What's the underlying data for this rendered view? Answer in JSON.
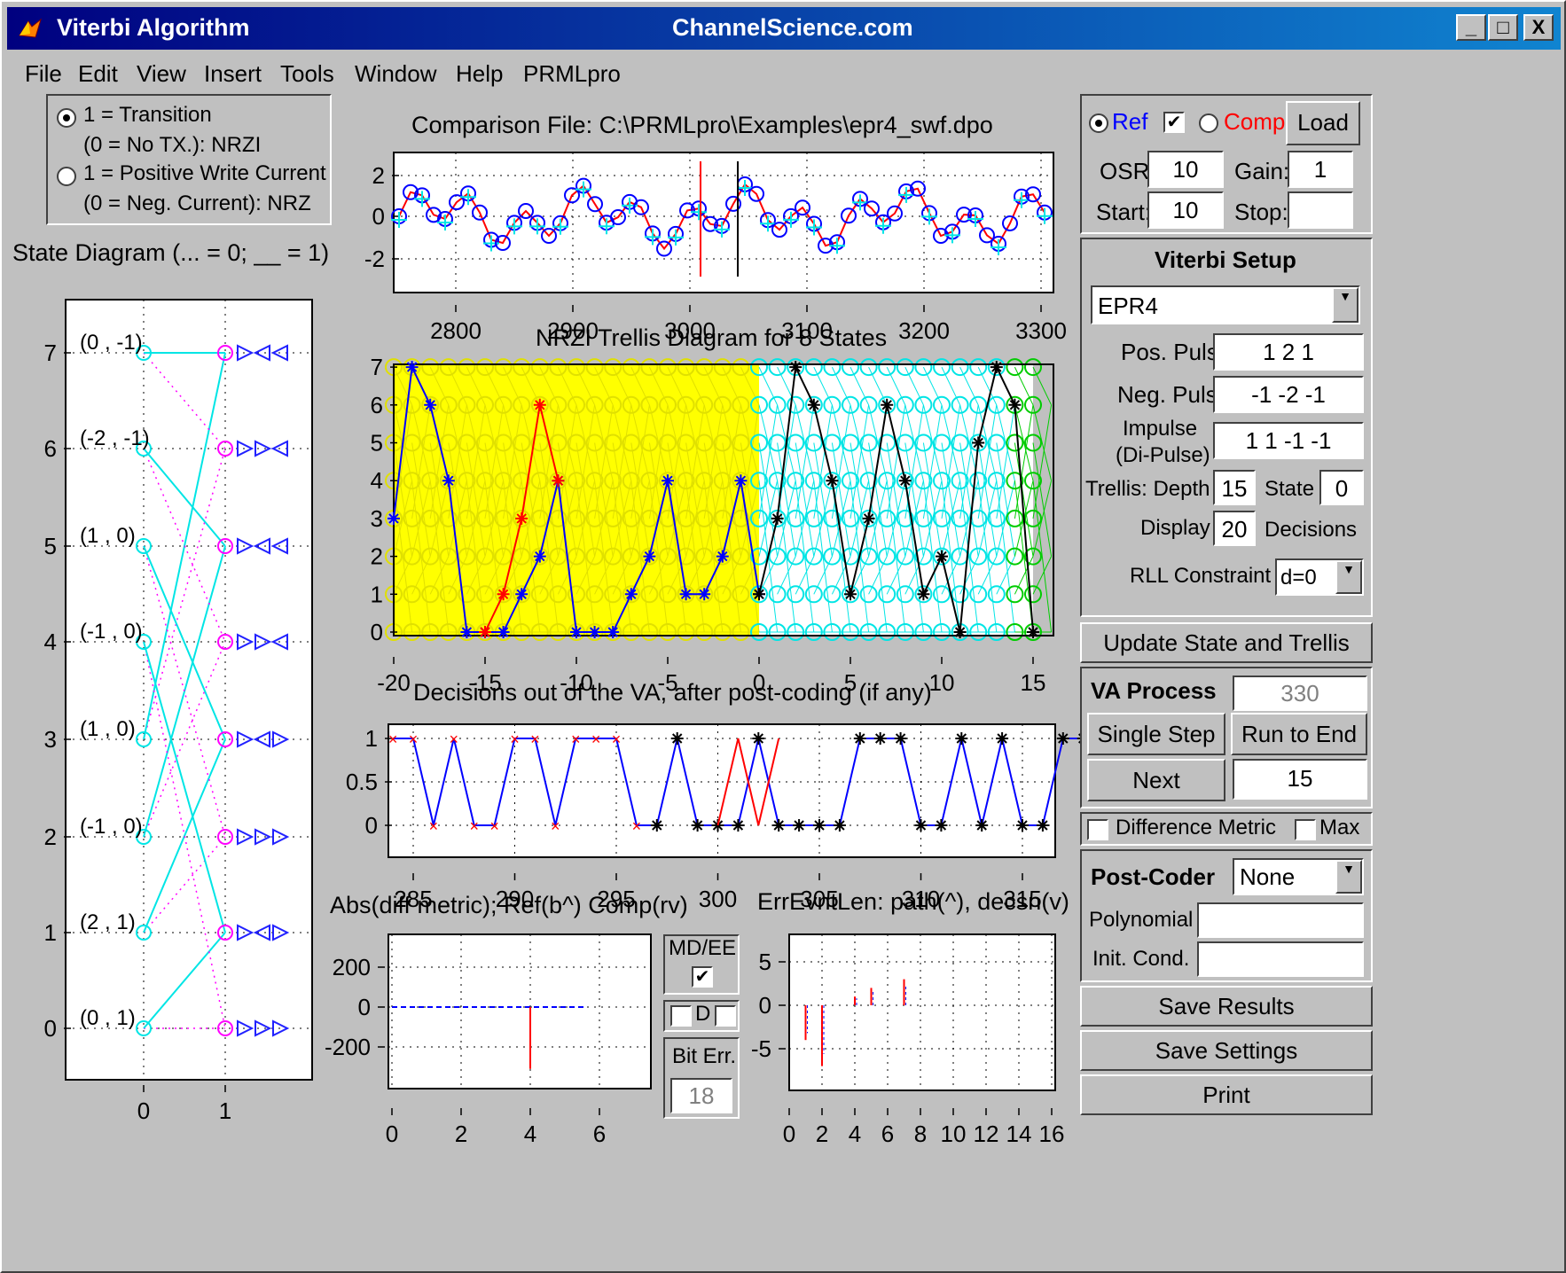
{
  "window": {
    "title": "Viterbi Algorithm",
    "center_title": "ChannelScience.com",
    "controls": {
      "minimize": "_",
      "maximize": "□",
      "close": "X"
    }
  },
  "menu": [
    "File",
    "Edit",
    "View",
    "Insert",
    "Tools",
    "Window",
    "Help",
    "PRMLpro"
  ],
  "mode_panel": {
    "opt1_line1": "1 = Transition",
    "opt1_line2": "(0 = No TX.): NRZI",
    "opt2_line1": "1 = Positive Write Current",
    "opt2_line2": "(0 = Neg. Current): NRZ",
    "selected": "transition"
  },
  "state_diagram": {
    "title": "State Diagram (... = 0; __ = 1)",
    "y_ticks": [
      "0",
      "1",
      "2",
      "3",
      "4",
      "5",
      "6",
      "7"
    ],
    "x_ticks": [
      "0",
      "1"
    ],
    "node_labels": [
      "(0 , 1)",
      "(2 , 1)",
      "(-1 , 0)",
      "(1 , 0)",
      "(-1 , 0)",
      "(1 , 0)",
      "(-2 , -1)",
      "(0 , -1)"
    ]
  },
  "comparison": {
    "title": "Comparison File: C:\\PRMLpro\\Examples\\epr4_swf.dpo",
    "x_ticks": [
      "2800",
      "2900",
      "3000",
      "3100",
      "3200",
      "3300"
    ],
    "y_ticks": [
      "2",
      "0",
      "-2"
    ]
  },
  "trellis": {
    "title": "NRZI Trellis Diagram for 8 States",
    "xlabel": "Decisions out of the VA, after post-coding (if any)",
    "x_ticks": [
      "-20",
      "-15",
      "-10",
      "-5",
      "0",
      "5",
      "10",
      "15"
    ],
    "y_ticks": [
      "0",
      "1",
      "2",
      "3",
      "4",
      "5",
      "6",
      "7"
    ]
  },
  "decisions_plot": {
    "x_ticks": [
      "285",
      "290",
      "295",
      "300",
      "305",
      "310",
      "315"
    ],
    "y_ticks": [
      "1",
      "0.5",
      "0"
    ]
  },
  "diff_metric_plot": {
    "title": "Abs(diff metric); Ref(b^) Comp(rv)",
    "x_ticks": [
      "0",
      "2",
      "4",
      "6"
    ],
    "y_ticks": [
      "200",
      "0",
      "-200"
    ]
  },
  "err_event_plot": {
    "title": "ErrEvntLen: path(^), decsn(v)",
    "x_ticks": [
      "0",
      "2",
      "4",
      "6",
      "8",
      "10",
      "12",
      "14",
      "16"
    ],
    "y_ticks": [
      "5",
      "0",
      "-5"
    ]
  },
  "mid_controls": {
    "mdee_label": "MD/EE",
    "mdee_checked": true,
    "d_label": "D",
    "bit_err_label": "Bit Err.",
    "bit_err_value": "18"
  },
  "ref_panel": {
    "ref_label": "Ref",
    "comp_label": "Comp",
    "load_label": "Load",
    "ref_checked": true,
    "osr_label": "OSR:",
    "osr_value": "10",
    "gain_label": "Gain:",
    "gain_value": "1",
    "start_label": "Start:",
    "start_value": "10",
    "stop_label": "Stop:",
    "stop_value": ""
  },
  "viterbi_setup": {
    "title": "Viterbi Setup",
    "channel": "EPR4",
    "pos_pulse_label": "Pos. Pulse",
    "pos_pulse_value": "1 2 1",
    "neg_pulse_label": "Neg. Pulse",
    "neg_pulse_value": "-1 -2 -1",
    "impulse_label_1": "Impulse",
    "impulse_label_2": "(Di-Pulse)",
    "impulse_value": "1 1 -1 -1",
    "depth_label": "Trellis: Depth",
    "depth_value": "15",
    "state_label": "State",
    "state_value": "0",
    "display_label": "Display",
    "display_value": "20",
    "decisions_label": "Decisions",
    "rll_label": "RLL Constraint",
    "rll_value": "d=0"
  },
  "update_button": "Update State and Trellis",
  "va_process": {
    "title": "VA Process",
    "counter": "330",
    "single_step": "Single Step",
    "run_to_end": "Run to End",
    "next": "Next",
    "next_value": "15"
  },
  "difference_metric": {
    "label": "Difference Metric",
    "max_label": "Max"
  },
  "post_coder": {
    "title": "Post-Coder",
    "value": "None",
    "polynomial_label": "Polynomial",
    "polynomial_value": "",
    "init_cond_label": "Init. Cond.",
    "init_cond_value": ""
  },
  "bottom_buttons": {
    "save_results": "Save Results",
    "save_settings": "Save Settings",
    "print": "Print"
  },
  "colors": {
    "title_bar": "#000080",
    "ref": "#0000ff",
    "comp": "#ff0000",
    "trellis_bg_left": "#ffff00",
    "trellis_bg_right": "#00ffff",
    "trellis_bg_green": "#00cc00"
  }
}
